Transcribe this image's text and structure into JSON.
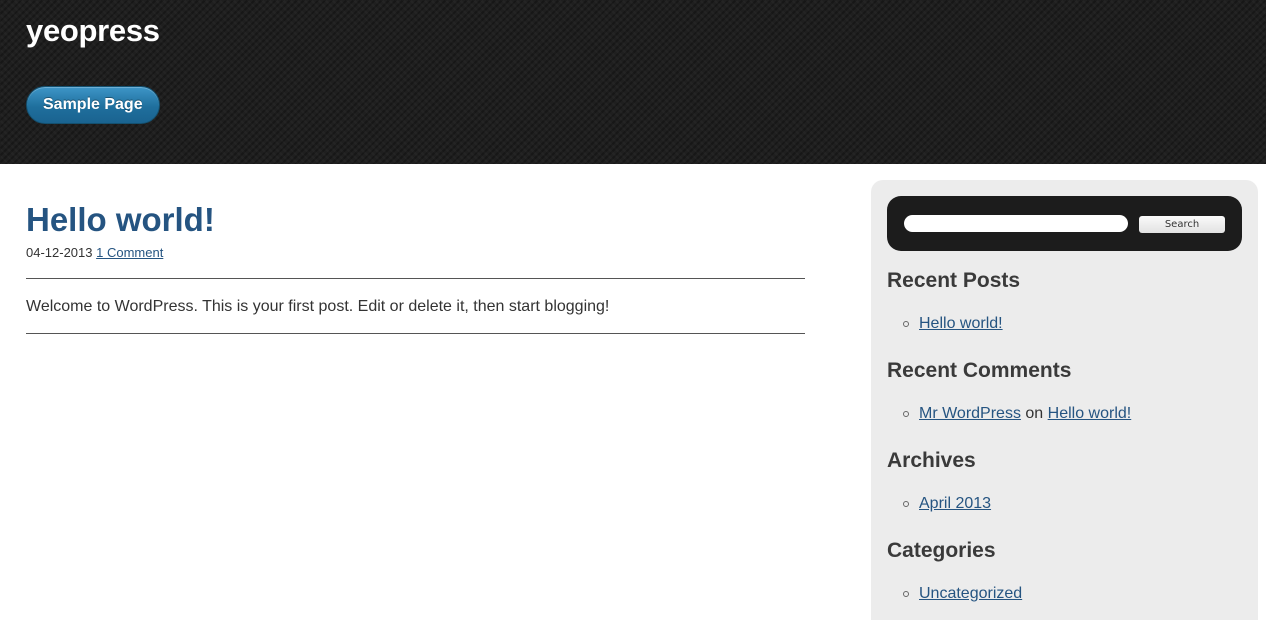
{
  "header": {
    "site_title": "yeopress",
    "nav": [
      {
        "label": "Sample Page"
      }
    ]
  },
  "post": {
    "title": "Hello world!",
    "date": "04-12-2013",
    "comments_link": "1 Comment",
    "content": "Welcome to WordPress. This is your first post. Edit or delete it, then start blogging!"
  },
  "sidebar": {
    "search": {
      "value": "",
      "button_label": "Search"
    },
    "recent_posts": {
      "title": "Recent Posts",
      "items": [
        {
          "label": "Hello world!"
        }
      ]
    },
    "recent_comments": {
      "title": "Recent Comments",
      "items": [
        {
          "author": "Mr WordPress",
          "connector": "on",
          "post": "Hello world!"
        }
      ]
    },
    "archives": {
      "title": "Archives",
      "items": [
        {
          "label": "April 2013"
        }
      ]
    },
    "categories": {
      "title": "Categories",
      "items": [
        {
          "label": "Uncategorized"
        }
      ]
    }
  },
  "colors": {
    "header_bg": "#1f1f1f",
    "nav_button": "#1f6f9d",
    "link": "#255481",
    "sidebar_bg": "#ececec",
    "search_bg": "#1c1c1c"
  }
}
